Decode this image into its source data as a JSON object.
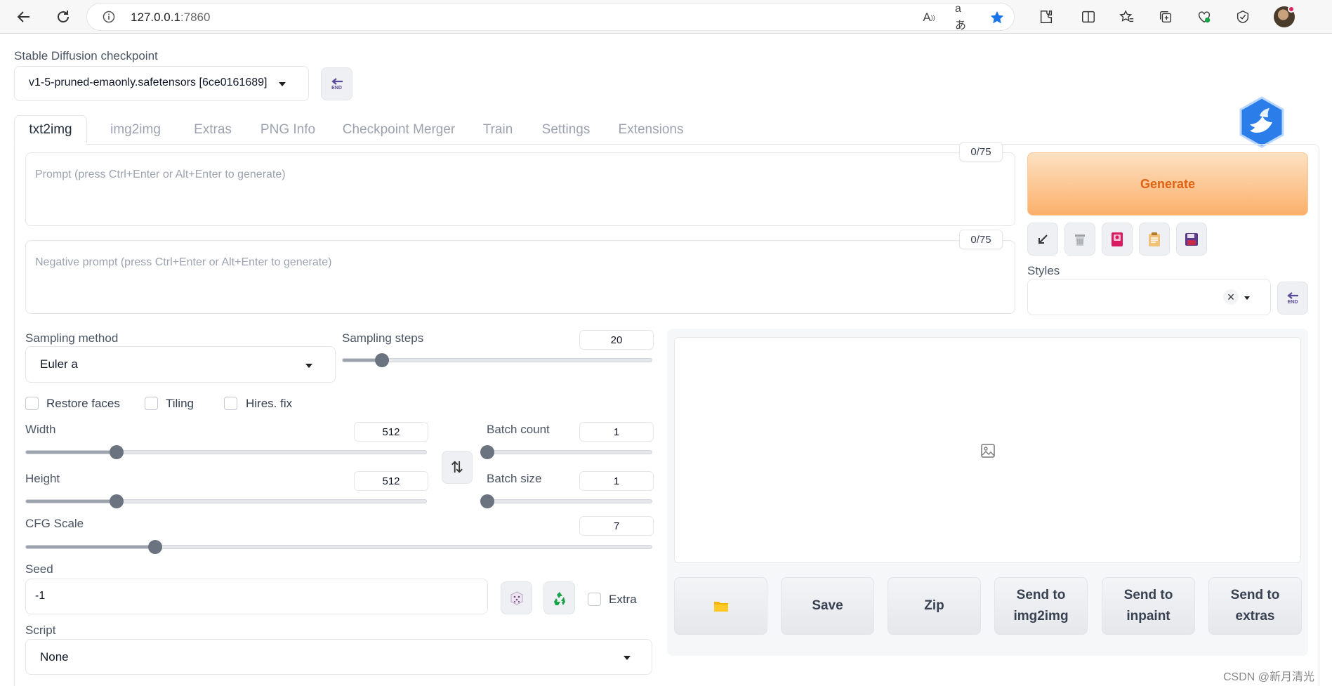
{
  "browser": {
    "url_host": "127.0.0.1",
    "url_port": ":7860"
  },
  "checkpoint": {
    "label": "Stable Diffusion checkpoint",
    "value": "v1-5-pruned-emaonly.safetensors [6ce0161689]",
    "refresh_icon_text": "END"
  },
  "tabs": [
    {
      "label": "txt2img",
      "active": true
    },
    {
      "label": "img2img",
      "active": false
    },
    {
      "label": "Extras",
      "active": false
    },
    {
      "label": "PNG Info",
      "active": false
    },
    {
      "label": "Checkpoint Merger",
      "active": false
    },
    {
      "label": "Train",
      "active": false
    },
    {
      "label": "Settings",
      "active": false
    },
    {
      "label": "Extensions",
      "active": false
    }
  ],
  "prompt": {
    "placeholder": "Prompt (press Ctrl+Enter or Alt+Enter to generate)",
    "counter": "0/75"
  },
  "negative_prompt": {
    "placeholder": "Negative prompt (press Ctrl+Enter or Alt+Enter to generate)",
    "counter": "0/75"
  },
  "generate": {
    "label": "Generate"
  },
  "styles": {
    "label": "Styles",
    "value": "",
    "clear_glyph": "×",
    "refresh_icon_text": "END"
  },
  "sampling_method": {
    "label": "Sampling method",
    "value": "Euler a"
  },
  "sampling_steps": {
    "label": "Sampling steps",
    "value": "20",
    "min": 1,
    "max": 150
  },
  "checkboxes": {
    "restore_faces": "Restore faces",
    "tiling": "Tiling",
    "hires_fix": "Hires. fix",
    "extra": "Extra"
  },
  "width": {
    "label": "Width",
    "value": "512",
    "min": 64,
    "max": 2048
  },
  "height": {
    "label": "Height",
    "value": "512",
    "min": 64,
    "max": 2048
  },
  "swap_glyph": "⇅",
  "batch_count": {
    "label": "Batch count",
    "value": "1",
    "min": 1,
    "max": 100
  },
  "batch_size": {
    "label": "Batch size",
    "value": "1",
    "min": 1,
    "max": 8
  },
  "cfg_scale": {
    "label": "CFG Scale",
    "value": "7",
    "min": 1,
    "max": 30
  },
  "seed": {
    "label": "Seed",
    "value": "-1"
  },
  "script": {
    "label": "Script",
    "value": "None"
  },
  "output_buttons": {
    "save": "Save",
    "zip": "Zip",
    "send_img2img": "Send to img2img",
    "send_inpaint": "Send to inpaint",
    "send_extras": "Send to extras"
  },
  "watermark": "CSDN @新月清光",
  "colors": {
    "generate_text": "#e06213",
    "generate_gradient_top": "#fde1c2",
    "generate_gradient_bottom": "#fbb06b",
    "slider_thumb": "#6b7280"
  }
}
